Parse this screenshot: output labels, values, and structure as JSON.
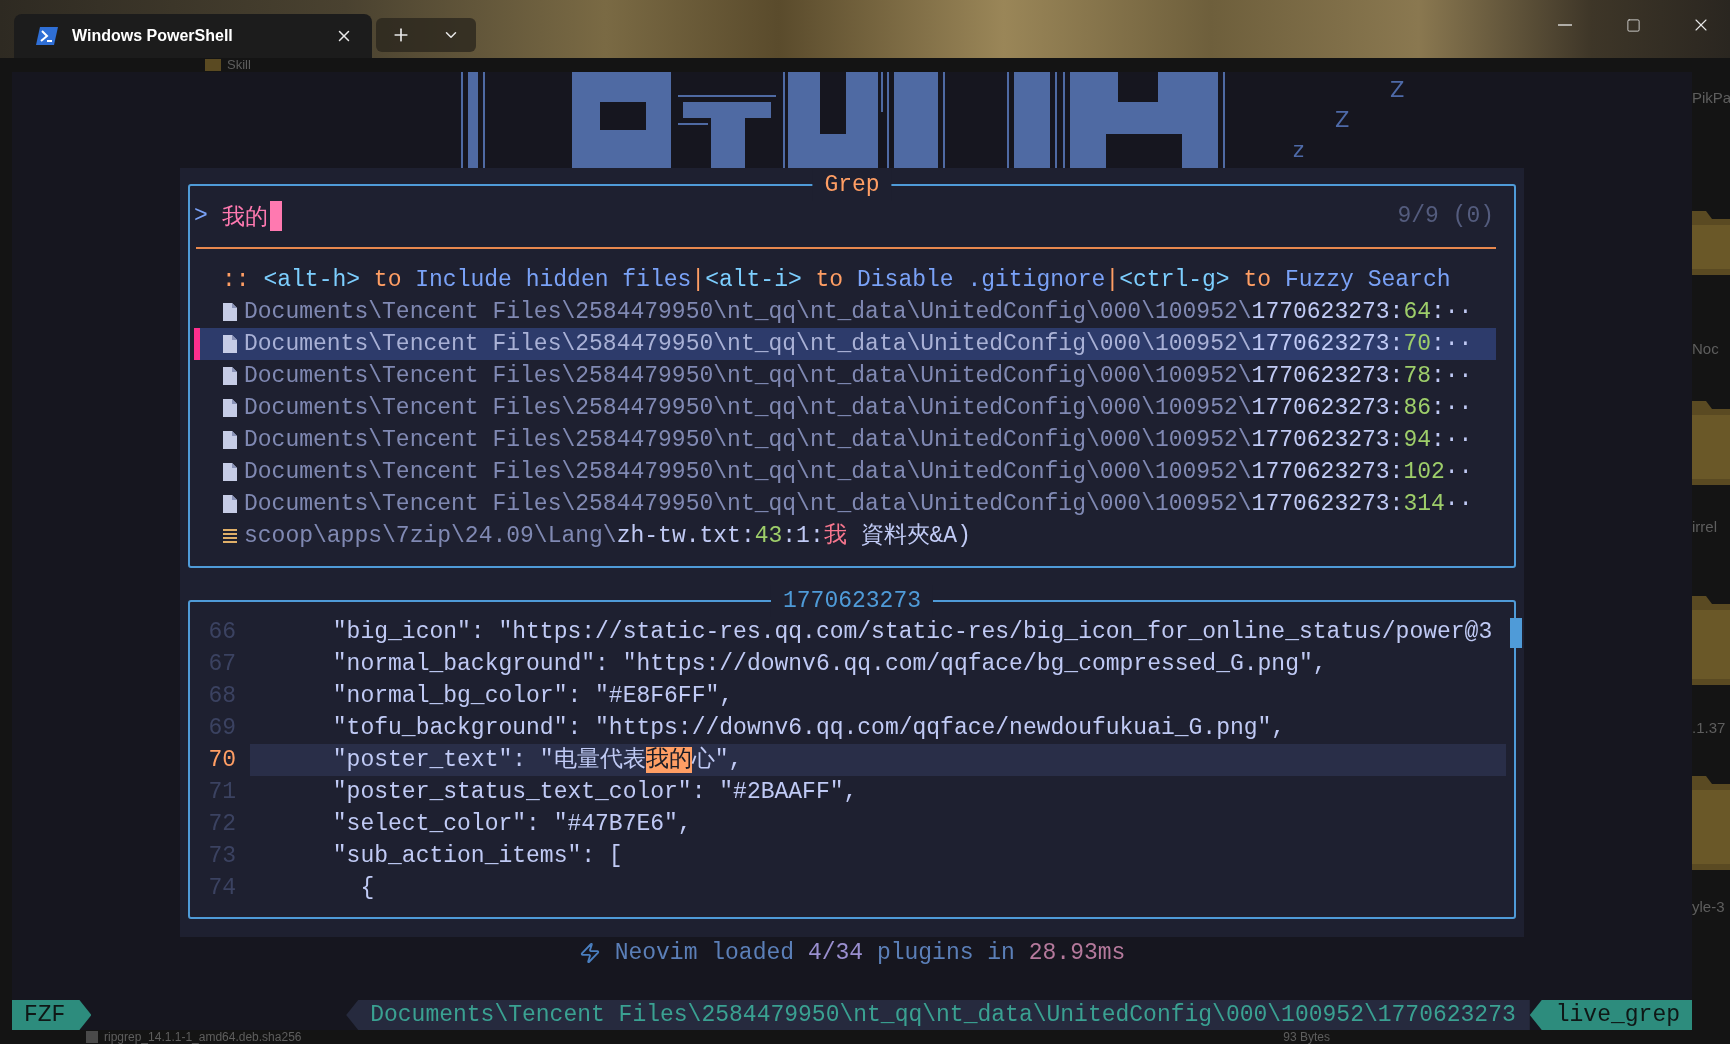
{
  "window": {
    "tab_title": "Windows PowerShell"
  },
  "desktop": {
    "top_label": "Skill",
    "side_labels": [
      "PikPa",
      "Noc",
      "irrel",
      ".1.37",
      "yle-3"
    ],
    "bottom_file": "ripgrep_14.1.1-1_amd64.deb.sha256",
    "bottom_size": "93 Bytes"
  },
  "dashboard": {
    "sleep_marks": [
      "Z",
      "Z",
      "z"
    ]
  },
  "grep": {
    "title": "Grep",
    "prompt": ">",
    "query": "我的",
    "count": "9/9 (0)",
    "help": [
      {
        "kind": "marker",
        "text": ":: "
      },
      {
        "kind": "key",
        "text": "<alt-h>"
      },
      {
        "kind": "connector",
        "text": " to "
      },
      {
        "kind": "action",
        "text": "Include hidden files"
      },
      {
        "kind": "divider",
        "text": "|"
      },
      {
        "kind": "key",
        "text": "<alt-i>"
      },
      {
        "kind": "connector",
        "text": " to "
      },
      {
        "kind": "action",
        "text": "Disable .gitignore"
      },
      {
        "kind": "divider",
        "text": "|"
      },
      {
        "kind": "key",
        "text": "<ctrl-g>"
      },
      {
        "kind": "connector",
        "text": " to "
      },
      {
        "kind": "action",
        "text": "Fuzzy Search"
      }
    ],
    "results": [
      {
        "kind": "file",
        "selected": false,
        "path": "Documents\\Tencent Files\\2584479950\\nt_qq\\nt_data\\UnitedConfig\\000\\100952\\",
        "file": "1770623273:",
        "line": "64",
        "tail": ":··"
      },
      {
        "kind": "file",
        "selected": true,
        "path": "Documents\\Tencent Files\\2584479950\\nt_qq\\nt_data\\UnitedConfig\\000\\100952\\",
        "file": "1770623273:",
        "line": "70",
        "tail": ":··"
      },
      {
        "kind": "file",
        "selected": false,
        "path": "Documents\\Tencent Files\\2584479950\\nt_qq\\nt_data\\UnitedConfig\\000\\100952\\",
        "file": "1770623273:",
        "line": "78",
        "tail": ":··"
      },
      {
        "kind": "file",
        "selected": false,
        "path": "Documents\\Tencent Files\\2584479950\\nt_qq\\nt_data\\UnitedConfig\\000\\100952\\",
        "file": "1770623273:",
        "line": "86",
        "tail": ":··"
      },
      {
        "kind": "file",
        "selected": false,
        "path": "Documents\\Tencent Files\\2584479950\\nt_qq\\nt_data\\UnitedConfig\\000\\100952\\",
        "file": "1770623273:",
        "line": "94",
        "tail": ":··"
      },
      {
        "kind": "file",
        "selected": false,
        "path": "Documents\\Tencent Files\\2584479950\\nt_qq\\nt_data\\UnitedConfig\\000\\100952\\",
        "file": "1770623273:",
        "line": "102",
        "tail": "··"
      },
      {
        "kind": "file",
        "selected": false,
        "path": "Documents\\Tencent Files\\2584479950\\nt_qq\\nt_data\\UnitedConfig\\000\\100952\\",
        "file": "1770623273:",
        "line": "314",
        "tail": "··"
      },
      {
        "kind": "text",
        "selected": false,
        "path": "scoop\\apps\\7zip\\24.09\\Lang\\",
        "file": "zh-tw.txt:",
        "line": "43",
        "tail": ":1:",
        "match": "我",
        "rest": " 資料夾&A)"
      }
    ]
  },
  "preview": {
    "title": "1770623273",
    "lines": [
      {
        "number": "66",
        "current": false,
        "text": "      \"big_icon\": \"https://static-res.qq.com/static-res/big_icon_for_online_status/power@3"
      },
      {
        "number": "67",
        "current": false,
        "text": "      \"normal_background\": \"https://downv6.qq.com/qqface/bg_compressed_G.png\","
      },
      {
        "number": "68",
        "current": false,
        "text": "      \"normal_bg_color\": \"#E8F6FF\","
      },
      {
        "number": "69",
        "current": false,
        "text": "      \"tofu_background\": \"https://downv6.qq.com/qqface/newdoufukuai_G.png\","
      },
      {
        "number": "70",
        "current": true,
        "text": "      \"poster_text\": \"电量代表",
        "match": "我的",
        "after": "心\","
      },
      {
        "number": "71",
        "current": false,
        "text": "      \"poster_status_text_color\": \"#2BAAFF\","
      },
      {
        "number": "72",
        "current": false,
        "text": "      \"select_color\": \"#47B7E6\","
      },
      {
        "number": "73",
        "current": false,
        "text": "      \"sub_action_items\": ["
      },
      {
        "number": "74",
        "current": false,
        "text": "        {"
      }
    ]
  },
  "startup": [
    {
      "kind": "text",
      "text": "Neovim loaded "
    },
    {
      "kind": "count",
      "text": "4/34"
    },
    {
      "kind": "text",
      "text": " plugins in "
    },
    {
      "kind": "time",
      "text": "28.93ms"
    }
  ],
  "status_bar": {
    "mode": "FZF",
    "path": "Documents\\Tencent Files\\2584479950\\nt_qq\\nt_data\\UnitedConfig\\000\\100952\\1770623273",
    "picker": "live_grep"
  }
}
